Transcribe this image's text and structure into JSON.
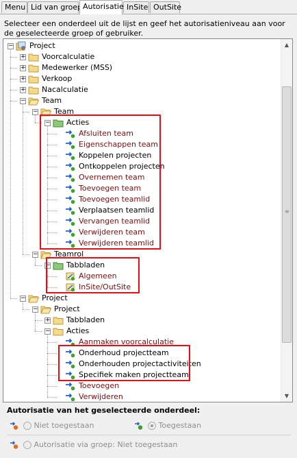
{
  "tabs": [
    {
      "label": "Menu"
    },
    {
      "label": "Lid van groep"
    },
    {
      "label": "Autorisatie"
    },
    {
      "label": "InSite"
    },
    {
      "label": "OutSite"
    }
  ],
  "instruction": "Selecteer een onderdeel uit de lijst en geef het autorisatieniveau aan voor de geselecteerde groep of gebruiker.",
  "tree": {
    "project": "Project",
    "voorcalculatie": "Voorcalculatie",
    "medewerker": "Medewerker (MSS)",
    "verkoop": "Verkoop",
    "nacalculatie": "Nacalculatie",
    "team": "Team",
    "team_sub": "Team",
    "acties": "Acties",
    "team_actions": [
      "Afsluiten team",
      "Eigenschappen team",
      "Koppelen projecten",
      "Ontkoppelen projecten",
      "Overnemen team",
      "Toevoegen team",
      "Toevoegen teamlid",
      "Verplaatsen teamlid",
      "Vervangen teamlid",
      "Verwijderen team",
      "Verwijderen teamlid"
    ],
    "teamrol": "Teamrol",
    "tabbladen": "Tabbladen",
    "teamrol_tabs": [
      "Algemeen",
      "InSite/OutSite"
    ],
    "project2": "Project",
    "project3": "Project",
    "tabbladen2": "Tabbladen",
    "acties2": "Acties",
    "project_actions": [
      "Aanmaken voorcalculatie",
      "Onderhoud projectteam",
      "Onderhouden projectactiviteiten",
      "Specifiek maken projectteam",
      "Toevoegen",
      "Verwijderen"
    ]
  },
  "authorization": {
    "group_title": "Autorisatie van het geselecteerde onderdeel:",
    "not_allowed": "Niet toegestaan",
    "allowed": "Toegestaan",
    "via_group": "Autorisatie via groep: Niet toegestaan"
  },
  "colors": {
    "selection_box": "#e3101a",
    "item_text_red": "#7a1010",
    "action_icon_arrow": "#1f5fd1",
    "action_icon_dot": "#3aa32a"
  }
}
